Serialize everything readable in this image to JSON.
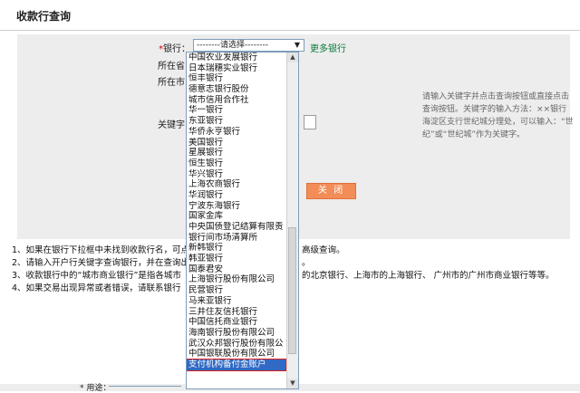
{
  "page": {
    "title": "收款行查询"
  },
  "form": {
    "bank_label": "银行：",
    "required_mark": "*",
    "bank_select_value": "--------请选择--------",
    "more_banks_link": "更多银行",
    "province_label": "所在省：",
    "city_label": "所在市：",
    "keyword_label": "关键字：",
    "hint": "请输入关键字并点击查询按钮或直接点击查询按钮。关键字的输入方法：××银行海淀区支行世纪城分理处，可以输入：“世纪”或“世纪城”作为关键字。",
    "close_button": "关 闭"
  },
  "notes": [
    {
      "left": "1、如果在银行下拉框中未找到收款行名，可点",
      "right": "高级查询。"
    },
    {
      "left": "2、请输入开户行关键字查询银行，并在查询出",
      "right": "。"
    },
    {
      "left": "3、收款银行中的“城市商业银行”是指各城市",
      "right": "的北京银行、上海市的上海银行、 广州市的广州市商业银行等等。"
    },
    {
      "left": "4、如果交易出现异常或者错误，请联系银行",
      "right": ""
    }
  ],
  "bottom": {
    "usage_label": "* 用途："
  },
  "dropdown": {
    "items": [
      "中国农业发展银行",
      "日本瑞穗实业银行",
      "恒丰银行",
      "德意志银行股份",
      "城市信用合作社",
      "华一银行",
      "东亚银行",
      "华侨永亨银行",
      "美国银行",
      "星展银行",
      "恒生银行",
      "华兴银行",
      "上海农商银行",
      "华润银行",
      "宁波东海银行",
      "国家金库",
      "中央国债登记结算有限责",
      "银行间市场清算所",
      "新韩银行",
      "韩亚银行",
      "国泰君安",
      "上海银行股份有限公司",
      "民营银行",
      "马来亚银行",
      "三井住友信托银行",
      "中国信托商业银行",
      "海南银行股份有限公司",
      "武汉众邦银行股份有限公",
      "中国银联股份有限公司",
      "支付机构备付金账户"
    ],
    "selected_index": 29
  }
}
